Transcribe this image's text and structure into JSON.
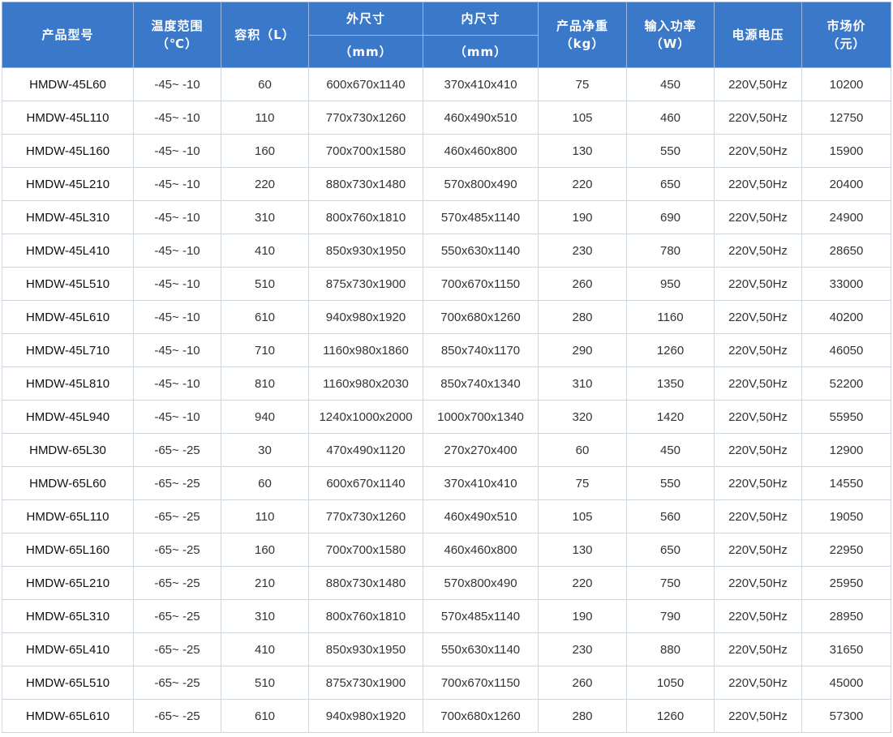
{
  "header": {
    "model": "产品型号",
    "temp_line1": "温度范围",
    "temp_line2": "（℃）",
    "volume": "容积（L）",
    "outer": "外尺寸",
    "outer_unit": "（mm）",
    "inner": "内尺寸",
    "inner_unit": "（mm）",
    "weight_line1": "产品净重",
    "weight_line2": "（kg）",
    "power_line1": "输入功率",
    "power_line2": "（W）",
    "voltage": "电源电压",
    "price_line1": "市场价",
    "price_line2": "（元）"
  },
  "rows": [
    {
      "model": "HMDW-45L60",
      "temp": "-45~ -10",
      "volume": "60",
      "outer": "600x670x1140",
      "inner": "370x410x410",
      "weight": "75",
      "power": "450",
      "voltage": "220V,50Hz",
      "price": "10200"
    },
    {
      "model": "HMDW-45L110",
      "temp": "-45~ -10",
      "volume": "110",
      "outer": "770x730x1260",
      "inner": "460x490x510",
      "weight": "105",
      "power": "460",
      "voltage": "220V,50Hz",
      "price": "12750"
    },
    {
      "model": "HMDW-45L160",
      "temp": "-45~ -10",
      "volume": "160",
      "outer": "700x700x1580",
      "inner": "460x460x800",
      "weight": "130",
      "power": "550",
      "voltage": "220V,50Hz",
      "price": "15900"
    },
    {
      "model": "HMDW-45L210",
      "temp": "-45~ -10",
      "volume": "220",
      "outer": "880x730x1480",
      "inner": "570x800x490",
      "weight": "220",
      "power": "650",
      "voltage": "220V,50Hz",
      "price": "20400"
    },
    {
      "model": "HMDW-45L310",
      "temp": "-45~ -10",
      "volume": "310",
      "outer": "800x760x1810",
      "inner": "570x485x1140",
      "weight": "190",
      "power": "690",
      "voltage": "220V,50Hz",
      "price": "24900"
    },
    {
      "model": "HMDW-45L410",
      "temp": "-45~ -10",
      "volume": "410",
      "outer": "850x930x1950",
      "inner": "550x630x1140",
      "weight": "230",
      "power": "780",
      "voltage": "220V,50Hz",
      "price": "28650"
    },
    {
      "model": "HMDW-45L510",
      "temp": "-45~ -10",
      "volume": "510",
      "outer": "875x730x1900",
      "inner": "700x670x1150",
      "weight": "260",
      "power": "950",
      "voltage": "220V,50Hz",
      "price": "33000"
    },
    {
      "model": "HMDW-45L610",
      "temp": "-45~ -10",
      "volume": "610",
      "outer": "940x980x1920",
      "inner": "700x680x1260",
      "weight": "280",
      "power": "1160",
      "voltage": "220V,50Hz",
      "price": "40200"
    },
    {
      "model": "HMDW-45L710",
      "temp": "-45~ -10",
      "volume": "710",
      "outer": "1160x980x1860",
      "inner": "850x740x1170",
      "weight": "290",
      "power": "1260",
      "voltage": "220V,50Hz",
      "price": "46050"
    },
    {
      "model": "HMDW-45L810",
      "temp": "-45~ -10",
      "volume": "810",
      "outer": "1160x980x2030",
      "inner": "850x740x1340",
      "weight": "310",
      "power": "1350",
      "voltage": "220V,50Hz",
      "price": "52200"
    },
    {
      "model": "HMDW-45L940",
      "temp": "-45~ -10",
      "volume": "940",
      "outer": "1240x1000x2000",
      "inner": "1000x700x1340",
      "weight": "320",
      "power": "1420",
      "voltage": "220V,50Hz",
      "price": "55950"
    },
    {
      "model": "HMDW-65L30",
      "temp": "-65~ -25",
      "volume": "30",
      "outer": "470x490x1120",
      "inner": "270x270x400",
      "weight": "60",
      "power": "450",
      "voltage": "220V,50Hz",
      "price": "12900"
    },
    {
      "model": "HMDW-65L60",
      "temp": "-65~ -25",
      "volume": "60",
      "outer": "600x670x1140",
      "inner": "370x410x410",
      "weight": "75",
      "power": "550",
      "voltage": "220V,50Hz",
      "price": "14550"
    },
    {
      "model": "HMDW-65L110",
      "temp": "-65~ -25",
      "volume": "110",
      "outer": "770x730x1260",
      "inner": "460x490x510",
      "weight": "105",
      "power": "560",
      "voltage": "220V,50Hz",
      "price": "19050"
    },
    {
      "model": "HMDW-65L160",
      "temp": "-65~ -25",
      "volume": "160",
      "outer": "700x700x1580",
      "inner": "460x460x800",
      "weight": "130",
      "power": "650",
      "voltage": "220V,50Hz",
      "price": "22950"
    },
    {
      "model": "HMDW-65L210",
      "temp": "-65~ -25",
      "volume": "210",
      "outer": "880x730x1480",
      "inner": "570x800x490",
      "weight": "220",
      "power": "750",
      "voltage": "220V,50Hz",
      "price": "25950"
    },
    {
      "model": "HMDW-65L310",
      "temp": "-65~ -25",
      "volume": "310",
      "outer": "800x760x1810",
      "inner": "570x485x1140",
      "weight": "190",
      "power": "790",
      "voltage": "220V,50Hz",
      "price": "28950"
    },
    {
      "model": "HMDW-65L410",
      "temp": "-65~ -25",
      "volume": "410",
      "outer": "850x930x1950",
      "inner": "550x630x1140",
      "weight": "230",
      "power": "880",
      "voltage": "220V,50Hz",
      "price": "31650"
    },
    {
      "model": "HMDW-65L510",
      "temp": "-65~ -25",
      "volume": "510",
      "outer": "875x730x1900",
      "inner": "700x670x1150",
      "weight": "260",
      "power": "1050",
      "voltage": "220V,50Hz",
      "price": "45000"
    },
    {
      "model": "HMDW-65L610",
      "temp": "-65~ -25",
      "volume": "610",
      "outer": "940x980x1920",
      "inner": "700x680x1260",
      "weight": "280",
      "power": "1260",
      "voltage": "220V,50Hz",
      "price": "57300"
    }
  ],
  "colors": {
    "header_bg": "#3a78c9",
    "header_text": "#ffffff",
    "cell_text": "#333333",
    "grid_line": "#cfd5dd"
  }
}
